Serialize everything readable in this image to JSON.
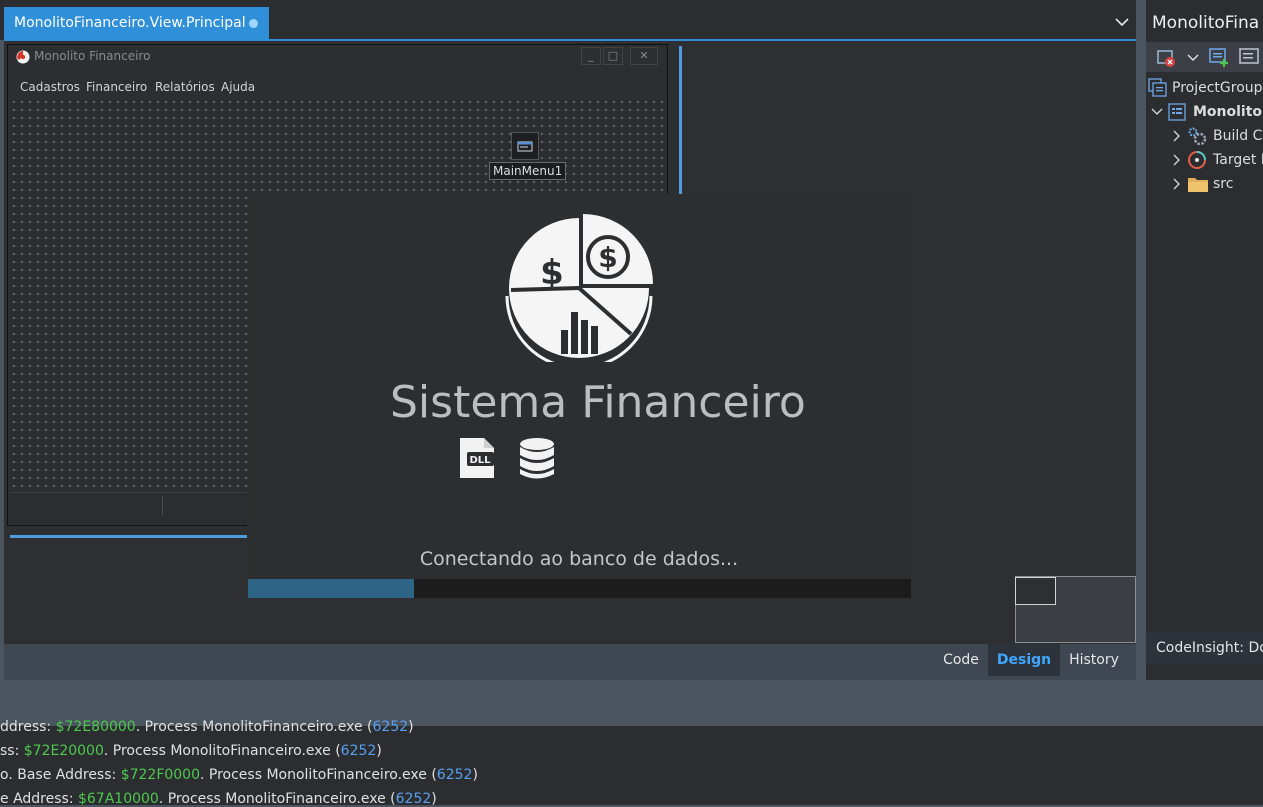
{
  "editor": {
    "tab_title": "MonolitoFinanceiro.View.Principal",
    "tab_list_icon": "chevron-down-icon"
  },
  "form": {
    "title": "Monolito Financeiro",
    "caption_buttons": [
      "_",
      "□",
      "✕"
    ],
    "menu": [
      "Cadastros",
      "Financeiro",
      "Relatórios",
      "Ajuda"
    ],
    "component_label": "MainMenu1"
  },
  "splash": {
    "title": "Sistema Financeiro",
    "status": "Conectando ao banco de dados...",
    "progress": 0.25,
    "icons": [
      "finance-pie-chart-icon",
      "dll-file-icon",
      "database-icon"
    ]
  },
  "view_tabs": {
    "code": "Code",
    "design": "Design",
    "history": "History"
  },
  "project": {
    "title": "MonolitoFina",
    "tree": [
      {
        "label": "ProjectGroup",
        "icon": "project-group-icon"
      },
      {
        "label": "MonolitoF",
        "icon": "project-icon"
      },
      {
        "label": "Build Co",
        "icon": "build-config-icon"
      },
      {
        "label": "Target P",
        "icon": "target-platform-icon"
      },
      {
        "label": "src",
        "icon": "folder-icon"
      }
    ],
    "codeinsight": "CodeInsight: Do"
  },
  "messages": [
    {
      "prefix": "ddress: ",
      "addr": "$72E80000",
      "mid": ". Process MonolitoFinanceiro.exe (",
      "pid": "6252",
      "end": ")"
    },
    {
      "prefix": "ss: ",
      "addr": "$72E20000",
      "mid": ". Process MonolitoFinanceiro.exe (",
      "pid": "6252",
      "end": ")"
    },
    {
      "prefix": "o. Base Address: ",
      "addr": "$722F0000",
      "mid": ". Process MonolitoFinanceiro.exe (",
      "pid": "6252",
      "end": ")"
    },
    {
      "prefix": "e Address: ",
      "addr": "$67A10000",
      "mid": ". Process MonolitoFinanceiro.exe (",
      "pid": "6252",
      "end": ")"
    }
  ],
  "colors": {
    "accent": "#2f8fd8",
    "progress": "#2e6587",
    "address": "#4ec94e",
    "pid": "#5aa0f0"
  }
}
